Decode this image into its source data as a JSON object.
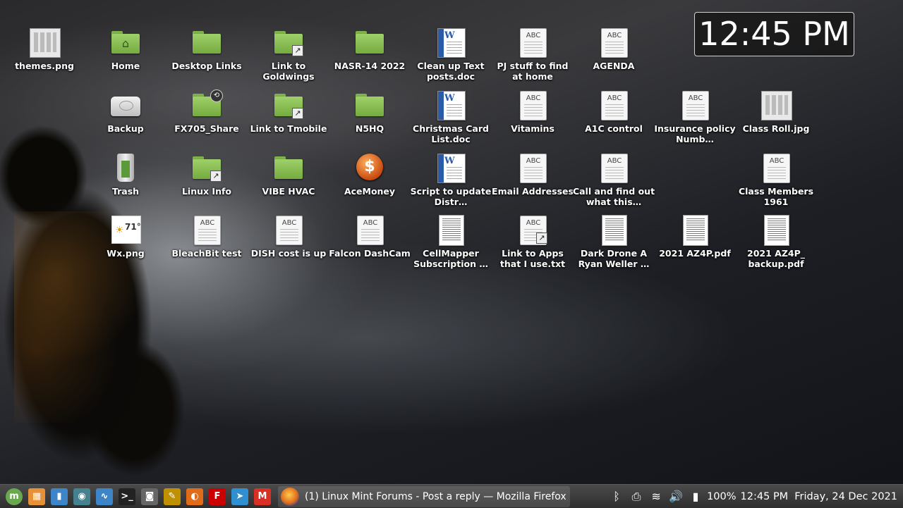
{
  "clock": {
    "time": "12:45 PM"
  },
  "desktop_icons": [
    {
      "label": "themes.png",
      "kind": "image"
    },
    {
      "label": "Home",
      "kind": "folder-home"
    },
    {
      "label": "Desktop Links",
      "kind": "folder"
    },
    {
      "label": "Link to Goldwings",
      "kind": "folder-link"
    },
    {
      "label": "NASR-14 2022",
      "kind": "folder"
    },
    {
      "label": "Clean up Text posts.doc",
      "kind": "word"
    },
    {
      "label": "PJ stuff to find at home",
      "kind": "text"
    },
    {
      "label": "AGENDA",
      "kind": "text"
    },
    {
      "label": "Backup",
      "kind": "drive"
    },
    {
      "label": "FX705_Share",
      "kind": "folder-share"
    },
    {
      "label": "Link to Tmobile",
      "kind": "folder-link"
    },
    {
      "label": "N5HQ",
      "kind": "folder"
    },
    {
      "label": "Christmas Card List.doc",
      "kind": "word"
    },
    {
      "label": "Vitamins",
      "kind": "text"
    },
    {
      "label": "A1C control",
      "kind": "text"
    },
    {
      "label": "Insurance policy Numb…",
      "kind": "text"
    },
    {
      "label": "Class Roll.jpg",
      "kind": "image"
    },
    {
      "label": "Trash",
      "kind": "trash"
    },
    {
      "label": "Linux Info",
      "kind": "folder-link"
    },
    {
      "label": "VIBE HVAC",
      "kind": "folder"
    },
    {
      "label": "AceMoney",
      "kind": "app-money"
    },
    {
      "label": "Script to update Distr…",
      "kind": "word"
    },
    {
      "label": "Email Addresses",
      "kind": "text"
    },
    {
      "label": "Call and find out what this…",
      "kind": "text"
    },
    {
      "label": "Class Members 1961",
      "kind": "text"
    },
    {
      "label": "Wx.png",
      "kind": "weather"
    },
    {
      "label": "BleachBit test",
      "kind": "text"
    },
    {
      "label": "DISH cost is up",
      "kind": "text"
    },
    {
      "label": "Falcon DashCam",
      "kind": "text"
    },
    {
      "label": "CellMapper Subscription …",
      "kind": "pdf"
    },
    {
      "label": "Link to Apps that I use.txt",
      "kind": "text-link"
    },
    {
      "label": "Dark Drone A Ryan Weller …",
      "kind": "pdf"
    },
    {
      "label": "2021 AZ4P.pdf",
      "kind": "pdf"
    },
    {
      "label": "2021 AZ4P_ backup.pdf",
      "kind": "pdf"
    }
  ],
  "icon_text": {
    "abc": "ABC",
    "word_letter": "W",
    "money_symbol": "$",
    "wx_temp": "71°"
  },
  "taskbar": {
    "launchers": [
      {
        "name": "mint-menu-icon",
        "color": "#6aa84f",
        "glyph": "m"
      },
      {
        "name": "color-picker-icon",
        "color": "#e69138",
        "glyph": "▦"
      },
      {
        "name": "ruler-icon",
        "color": "#3d85c6",
        "glyph": "▮"
      },
      {
        "name": "globe-icon",
        "color": "#45818e",
        "glyph": "◉"
      },
      {
        "name": "system-monitor-icon",
        "color": "#3d85c6",
        "glyph": "∿"
      },
      {
        "name": "terminal-icon",
        "color": "#222222",
        "glyph": ">_"
      },
      {
        "name": "camera-icon",
        "color": "#666666",
        "glyph": "◙"
      },
      {
        "name": "text-editor-icon",
        "color": "#bf9000",
        "glyph": "✎"
      },
      {
        "name": "firefox-icon",
        "color": "#e06c1a",
        "glyph": "◐"
      },
      {
        "name": "font-manager-icon",
        "color": "#cc0000",
        "glyph": "F"
      },
      {
        "name": "telegram-icon",
        "color": "#2f8fd0",
        "glyph": "➤"
      },
      {
        "name": "gmail-icon",
        "color": "#d93025",
        "glyph": "M"
      }
    ],
    "active_window": {
      "title": "(1) Linux Mint Forums - Post a reply — Mozilla Firefox",
      "icon_color": "#e06c1a"
    },
    "tray": {
      "icons": [
        "bluetooth-icon",
        "printer-icon",
        "wifi-icon",
        "volume-icon",
        "battery-icon"
      ],
      "icon_glyphs": {
        "bluetooth-icon": "ᛒ",
        "printer-icon": "⎙",
        "wifi-icon": "≋",
        "volume-icon": "🔊",
        "battery-icon": "▮"
      },
      "battery": "100%",
      "time": "12:45 PM",
      "date": "Friday, 24 Dec 2021"
    }
  }
}
